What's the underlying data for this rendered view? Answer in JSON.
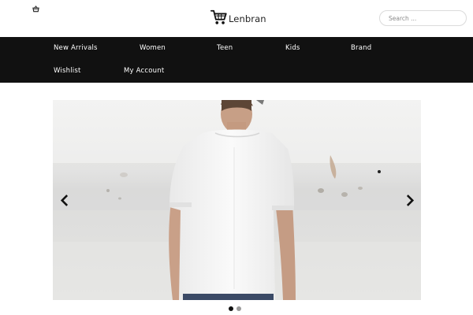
{
  "header": {
    "cart_icon": "basket-icon",
    "logo_icon": "shopping-cart-icon",
    "logo_text": "Lenbran",
    "search": {
      "placeholder": "Search ...",
      "value": ""
    }
  },
  "nav": {
    "items": [
      {
        "label": "New Arrivals"
      },
      {
        "label": "Women"
      },
      {
        "label": "Teen"
      },
      {
        "label": "Kids"
      },
      {
        "label": "Brand"
      },
      {
        "label": "Wishlist"
      },
      {
        "label": "My Account"
      }
    ]
  },
  "slider": {
    "prev_icon": "chevron-left-icon",
    "next_icon": "chevron-right-icon",
    "slide_count": 2,
    "active_index": 0
  },
  "colors": {
    "nav_bg": "#111111",
    "nav_text": "#ffffff",
    "dot_active": "#111111",
    "dot_inactive": "#9a9a9a"
  }
}
